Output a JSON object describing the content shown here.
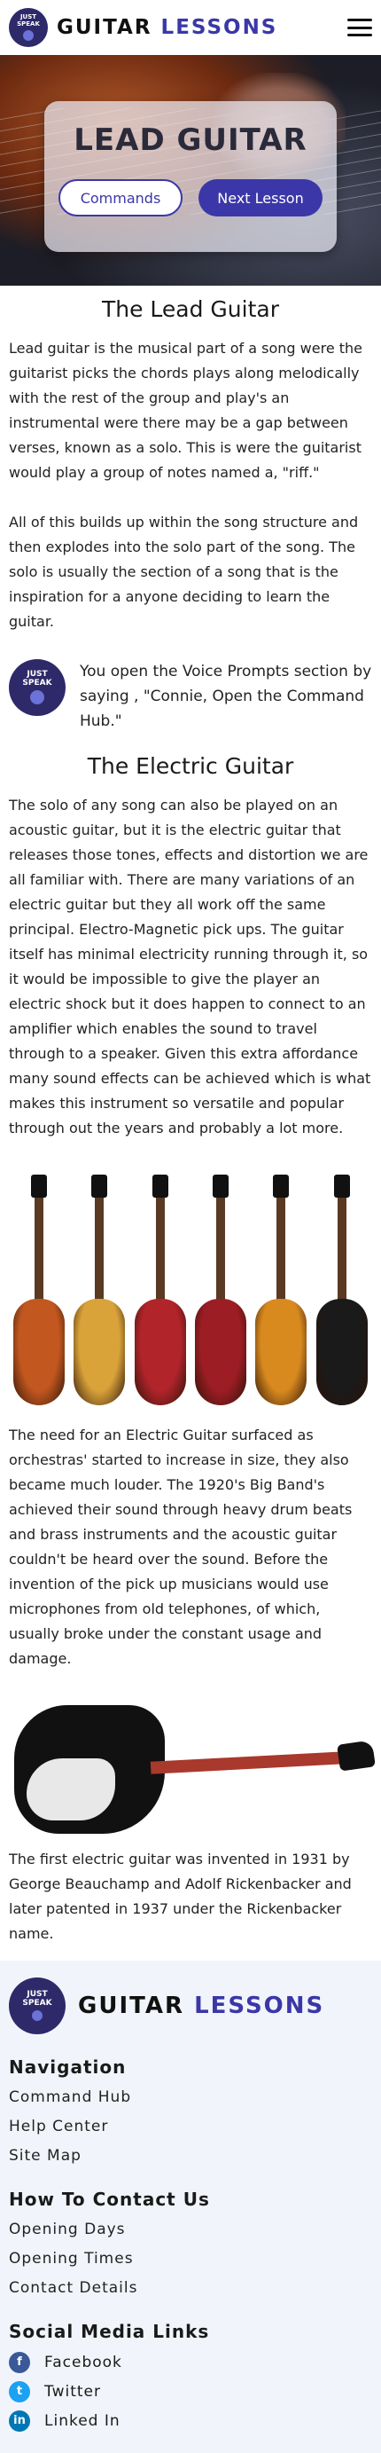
{
  "header": {
    "logo_line1": "JUST",
    "logo_line2": "SPEAK",
    "brand_part1": "GUITAR",
    "brand_part2": "LESSONS"
  },
  "hero": {
    "title": "LEAD GUITAR",
    "commands_button": "Commands",
    "next_button": "Next Lesson"
  },
  "section1": {
    "title": "The Lead Guitar",
    "paragraphs": [
      "Lead guitar is the musical part of a song were the guitarist picks the chords plays along melodically with the rest of the group and play's an instrumental were there may be a gap between verses, known as a solo. This is were the guitarist would play a group of notes named a, \"riff.\"",
      "All of this builds up within the song structure and then explodes into the solo part of the song. The solo is usually the section of a song that is the inspiration for a anyone deciding to learn the guitar."
    ]
  },
  "voice_tip": {
    "text": "You open the Voice Prompts section by saying , \"Connie, Open the Command Hub.\""
  },
  "section2": {
    "title": "The Electric Guitar",
    "paragraph1": "The solo of any song can also be played on an acoustic guitar, but it is the electric guitar that releases those tones, effects and distortion we are all familiar with. There are many variations of an electric guitar but they all work off the same principal. Electro-Magnetic pick ups. The guitar itself has minimal electricity running through it, so it would be impossible to give the player an electric shock but it does happen to connect to an amplifier which enables the sound to travel through to a speaker. Given this extra affordance many sound effects can be achieved which is what makes this instrument so versatile and popular through out the years and probably a lot more.",
    "paragraph2": "The need for an Electric Guitar surfaced as orchestras' started to increase in size, they also became much louder. The 1920's Big Band's achieved their sound through heavy drum beats and brass instruments and the acoustic guitar couldn't be heard over the sound. Before the invention of the pick up musicians would use microphones from old telephones, of which, usually broke under the constant usage and damage.",
    "paragraph3": "The first electric guitar was invented in 1931 by George Beauchamp and Adolf Rickenbacker and later patented in 1937 under the Rickenbacker name."
  },
  "guitar_colors": [
    "#c2571f",
    "#d9a33a",
    "#b0242a",
    "#9c1d24",
    "#d98a1f",
    "#1a1a1a"
  ],
  "footer": {
    "brand_part1": "GUITAR",
    "brand_part2": "LESSONS",
    "nav_heading": "Navigation",
    "nav_links": [
      "Command Hub",
      "Help Center",
      "Site Map"
    ],
    "contact_heading": "How To Contact Us",
    "contact_links": [
      "Opening Days",
      "Opening Times",
      "Contact Details"
    ],
    "social_heading": "Social Media Links",
    "social_links": [
      {
        "label": "Facebook",
        "icon": "facebook-icon",
        "color": "#3b5998"
      },
      {
        "label": "Twitter",
        "icon": "twitter-icon",
        "color": "#1da1f2"
      },
      {
        "label": "Linked In",
        "icon": "linkedin-icon",
        "color": "#0077b5"
      }
    ]
  }
}
